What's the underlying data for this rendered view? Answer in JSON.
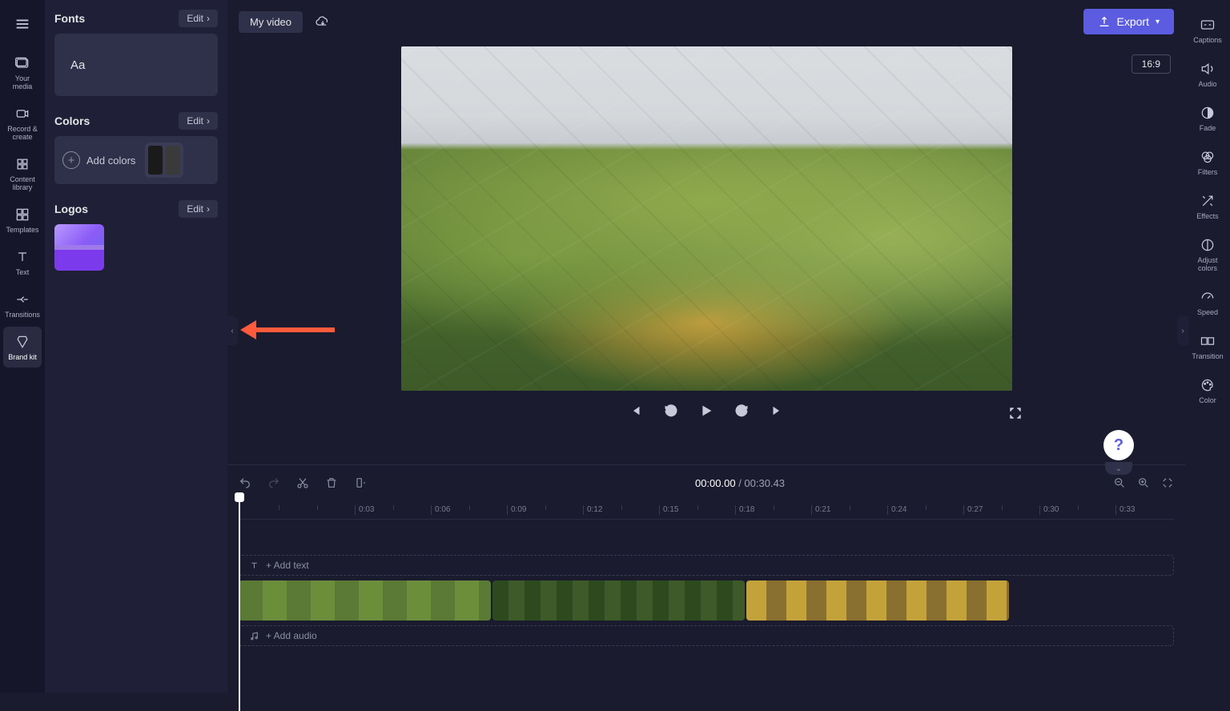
{
  "left_rail": {
    "your_media": "Your media",
    "record_create": "Record & create",
    "content_library": "Content library",
    "templates": "Templates",
    "text": "Text",
    "transitions": "Transitions",
    "brand_kit": "Brand kit"
  },
  "panel": {
    "fonts_title": "Fonts",
    "fonts_sample": "Aa",
    "colors_title": "Colors",
    "add_colors": "Add colors",
    "logos_title": "Logos",
    "edit": "Edit"
  },
  "header": {
    "project_title": "My video",
    "export": "Export",
    "aspect": "16:9"
  },
  "player": {
    "current_time": "00:00.00",
    "total_time": "00:30.43",
    "sep": " / "
  },
  "timeline": {
    "add_text": "+ Add text",
    "add_audio": "+ Add audio",
    "marks": [
      "0:03",
      "0:06",
      "0:09",
      "0:12",
      "0:15",
      "0:18",
      "0:21",
      "0:24",
      "0:27",
      "0:30",
      "0:33"
    ]
  },
  "right_rail": {
    "captions": "Captions",
    "audio": "Audio",
    "fade": "Fade",
    "filters": "Filters",
    "effects": "Effects",
    "adjust_colors": "Adjust colors",
    "speed": "Speed",
    "transition": "Transition",
    "color": "Color"
  },
  "help": "?"
}
